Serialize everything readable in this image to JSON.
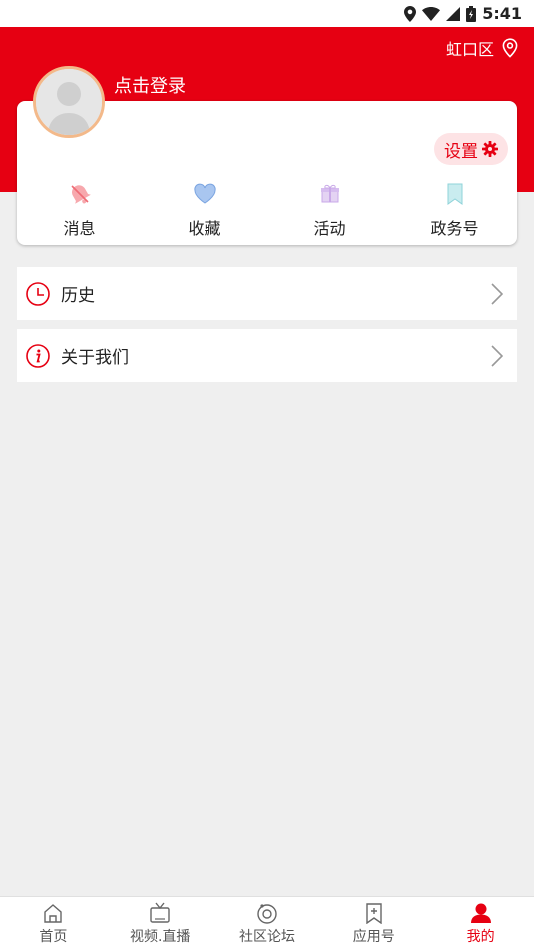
{
  "status_bar": {
    "time": "5:41"
  },
  "header": {
    "location": "虹口区",
    "login_text": "点击登录"
  },
  "card": {
    "settings_label": "设置",
    "quick_items": [
      {
        "label": "消息",
        "icon": "bell-icon"
      },
      {
        "label": "收藏",
        "icon": "heart-icon"
      },
      {
        "label": "活动",
        "icon": "gift-icon"
      },
      {
        "label": "政务号",
        "icon": "bookmark-icon"
      }
    ]
  },
  "list": [
    {
      "label": "历史",
      "icon": "clock-icon"
    },
    {
      "label": "关于我们",
      "icon": "info-icon"
    }
  ],
  "bottom_nav": [
    {
      "label": "首页",
      "icon": "home-icon"
    },
    {
      "label": "视频.直播",
      "icon": "tv-icon"
    },
    {
      "label": "社区论坛",
      "icon": "community-icon"
    },
    {
      "label": "应用号",
      "icon": "app-bookmark-icon"
    },
    {
      "label": "我的",
      "icon": "person-icon",
      "active": true
    }
  ],
  "colors": {
    "accent": "#e60012",
    "background": "#efefef",
    "card": "#ffffff"
  }
}
